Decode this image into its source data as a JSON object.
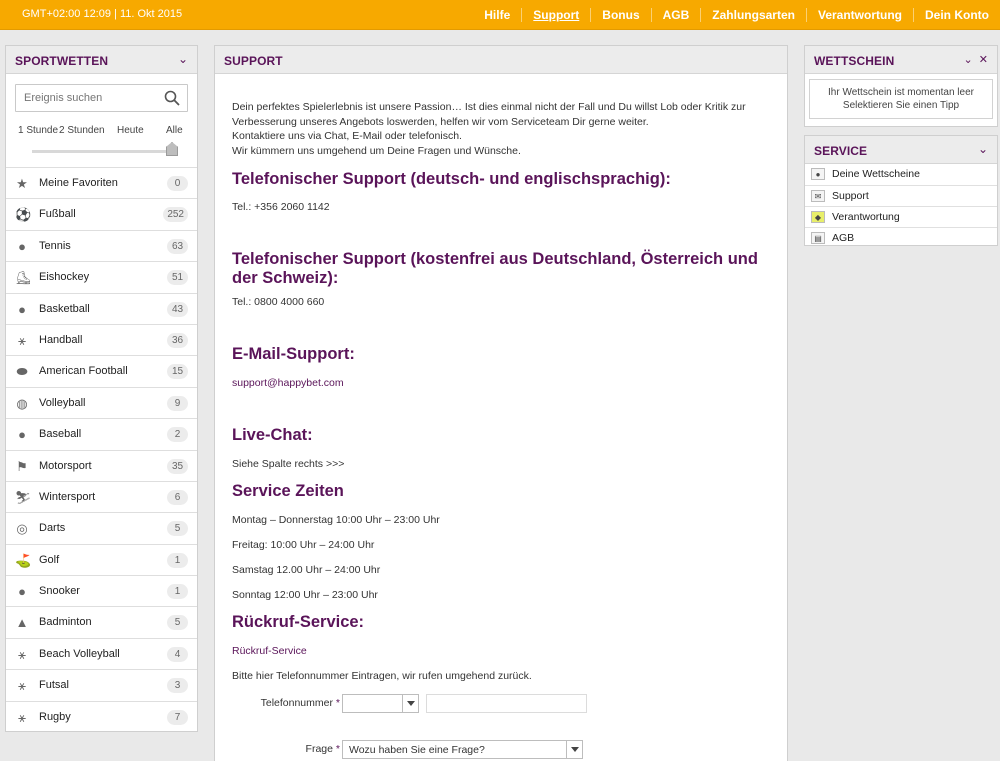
{
  "topbar": {
    "clock": "GMT+02:00 12:09 | 11. Okt 2015",
    "nav": [
      "Hilfe",
      "Support",
      "Bonus",
      "AGB",
      "Zahlungsarten",
      "Verantwortung",
      "Dein Konto"
    ],
    "active": "Support",
    "accent": "#f7a900"
  },
  "sidebar": {
    "title": "SPORTWETTEN",
    "search_placeholder": "Ereignis suchen",
    "range": [
      "1 Stunde",
      "2 Stunden",
      "Heute",
      "Alle"
    ],
    "range_selected": "Alle",
    "sports": [
      {
        "name": "Meine Favoriten",
        "count": "0",
        "icon": "star-icon"
      },
      {
        "name": "Fußball",
        "count": "252",
        "icon": "football-icon"
      },
      {
        "name": "Tennis",
        "count": "63",
        "icon": "tennis-icon"
      },
      {
        "name": "Eishockey",
        "count": "51",
        "icon": "ice-hockey-icon"
      },
      {
        "name": "Basketball",
        "count": "43",
        "icon": "basketball-icon"
      },
      {
        "name": "Handball",
        "count": "36",
        "icon": "handball-icon"
      },
      {
        "name": "American Football",
        "count": "15",
        "icon": "american-football-icon"
      },
      {
        "name": "Volleyball",
        "count": "9",
        "icon": "volleyball-icon"
      },
      {
        "name": "Baseball",
        "count": "2",
        "icon": "baseball-icon"
      },
      {
        "name": "Motorsport",
        "count": "35",
        "icon": "checkered-flag-icon"
      },
      {
        "name": "Wintersport",
        "count": "6",
        "icon": "skier-icon"
      },
      {
        "name": "Darts",
        "count": "5",
        "icon": "dartboard-icon"
      },
      {
        "name": "Golf",
        "count": "1",
        "icon": "golf-icon"
      },
      {
        "name": "Snooker",
        "count": "1",
        "icon": "snooker-icon"
      },
      {
        "name": "Badminton",
        "count": "5",
        "icon": "shuttlecock-icon"
      },
      {
        "name": "Beach Volleyball",
        "count": "4",
        "icon": "beach-volleyball-icon"
      },
      {
        "name": "Futsal",
        "count": "3",
        "icon": "futsal-icon"
      },
      {
        "name": "Rugby",
        "count": "7",
        "icon": "rugby-icon"
      }
    ]
  },
  "main": {
    "title": "SUPPORT",
    "intro": [
      "Dein perfektes Spielerlebnis ist unsere Passion… Ist dies einmal nicht der Fall und Du willst Lob oder Kritik zur",
      "Verbesserung unseres Angebots loswerden, helfen wir vom Serviceteam Dir gerne weiter.",
      "Kontaktiere uns via Chat, E-Mail oder telefonisch.",
      "Wir kümmern uns umgehend um Deine Fragen und Wünsche."
    ],
    "phone_intl_heading": "Telefonischer Support (deutsch- und englischsprachig):",
    "phone_intl": "Tel.:  +356 2060 1142",
    "phone_free_heading": "Telefonischer Support (kostenfrei aus Deutschland, Österreich und der Schweiz):",
    "phone_free": "Tel.:  0800 4000 660",
    "email_heading": "E-Mail-Support:",
    "email": "support@happybet.com",
    "chat_heading": "Live-Chat:",
    "chat_text": "Siehe Spalte rechts >>>",
    "hours_heading": "Service Zeiten",
    "hours": [
      "Montag – Donnerstag 10:00 Uhr – 23:00 Uhr",
      "Freitag: 10:00 Uhr – 24:00 Uhr",
      "Samstag 12.00 Uhr – 24:00 Uhr",
      "Sonntag 12:00 Uhr – 23:00 Uhr"
    ],
    "callback_heading": "Rückruf-Service:",
    "callback_link": "Rückruf-Service",
    "callback_text": "Bitte hier Telefonnummer Eintragen, wir rufen umgehend zurück.",
    "phone_label": "Telefonnummer",
    "required_mark": "*",
    "question_label": "Frage",
    "question_value": "Wozu haben Sie eine Frage?"
  },
  "betslip": {
    "title": "WETTSCHEIN",
    "empty_line1": "Ihr Wettschein ist momentan leer",
    "empty_line2": "Selektieren Sie einen Tipp"
  },
  "service": {
    "title": "SERVICE",
    "items": [
      {
        "label": "Deine Wettscheine",
        "icon": "user-icon"
      },
      {
        "label": "Support",
        "icon": "envelope-icon"
      },
      {
        "label": "Verantwortung",
        "icon": "responsibility-icon"
      },
      {
        "label": "AGB",
        "icon": "book-icon"
      }
    ]
  }
}
